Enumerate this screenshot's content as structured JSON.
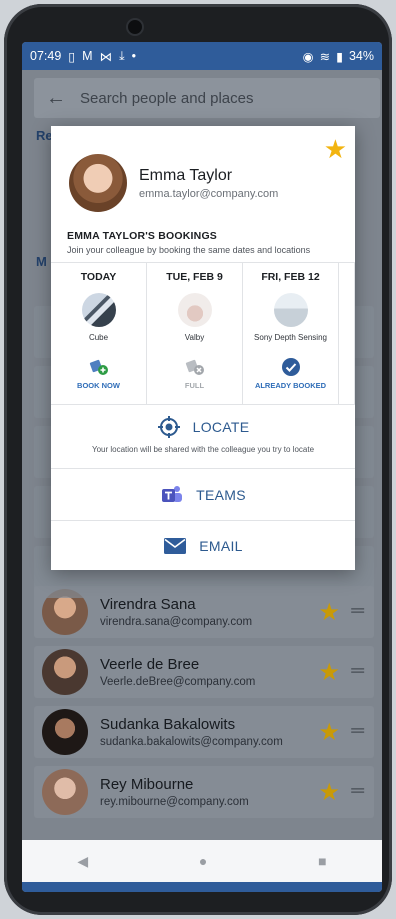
{
  "status": {
    "time": "07:49",
    "battery": "34%"
  },
  "search": {
    "placeholder": "Search people and places"
  },
  "background": {
    "label_r": "Re",
    "label_m": "M"
  },
  "dialog": {
    "name": "Emma Taylor",
    "email": "emma.taylor@company.com",
    "bookings_title": "EMMA TAYLOR'S BOOKINGS",
    "bookings_subtitle": "Join your colleague by booking the same dates and locations",
    "columns": [
      {
        "day": "TODAY",
        "place": "Cube",
        "action": "BOOK NOW",
        "icon": "book-now-icon"
      },
      {
        "day": "TUE, FEB 9",
        "place": "Valby",
        "action": "FULL",
        "icon": "full-icon"
      },
      {
        "day": "FRI, FEB 12",
        "place": "Sony Depth Sensing",
        "action": "ALREADY BOOKED",
        "icon": "check-icon"
      }
    ],
    "locate_label": "LOCATE",
    "locate_note": "Your location will be shared with the colleague you try to locate",
    "teams_label": "TEAMS",
    "email_label": "EMAIL"
  },
  "people": [
    {
      "name": "Virendra Sana",
      "email": "virendra.sana@company.com",
      "color": "#7a5a48"
    },
    {
      "name": "Veerle de Bree",
      "email": "Veerle.deBree@company.com",
      "color": "#5c4638"
    },
    {
      "name": "Sudanka Bakalowits",
      "email": "sudanka.bakalowits@company.com",
      "color": "#3c2e2a"
    },
    {
      "name": "Rey Mibourne",
      "email": "rey.mibourne@company.com",
      "color": "#8d6a58"
    }
  ],
  "colors": {
    "accent": "#2f5c9a",
    "star": "#f2b410",
    "link": "#2d5a8f"
  }
}
